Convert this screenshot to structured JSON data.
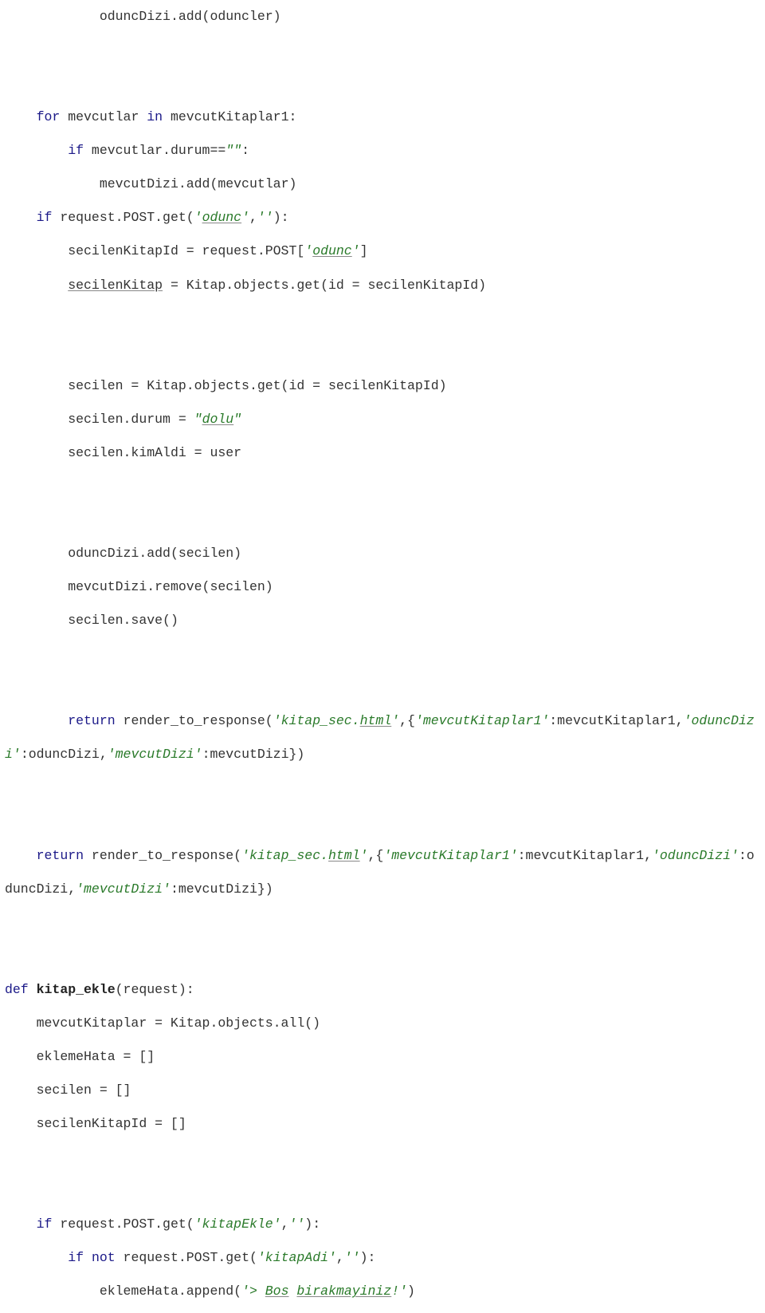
{
  "code": {
    "tokens": [
      {
        "t": "            oduncDizi.add(oduncler)\n"
      },
      {
        "t": "\n"
      },
      {
        "t": "\n"
      },
      {
        "t": "    "
      },
      {
        "t": "for",
        "c": "kw"
      },
      {
        "t": " mevcutlar "
      },
      {
        "t": "in",
        "c": "kw"
      },
      {
        "t": " mevcutKitaplar1:\n"
      },
      {
        "t": "        "
      },
      {
        "t": "if",
        "c": "kw"
      },
      {
        "t": " mevcutlar.durum=="
      },
      {
        "t": "\"\"",
        "c": "str"
      },
      {
        "t": ":\n"
      },
      {
        "t": "            mevcutDizi.add(mevcutlar)\n"
      },
      {
        "t": "    "
      },
      {
        "t": "if",
        "c": "kw"
      },
      {
        "t": " request.POST.get("
      },
      {
        "t": "'",
        "c": "str"
      },
      {
        "t": "odunc",
        "c": "str u"
      },
      {
        "t": "'",
        "c": "str"
      },
      {
        "t": ","
      },
      {
        "t": "''",
        "c": "str"
      },
      {
        "t": "):\n"
      },
      {
        "t": "        secilenKitapId = request.POST["
      },
      {
        "t": "'",
        "c": "str"
      },
      {
        "t": "odunc",
        "c": "str u"
      },
      {
        "t": "'",
        "c": "str"
      },
      {
        "t": "]\n"
      },
      {
        "t": "        "
      },
      {
        "t": "secilenKitap",
        "c": "u"
      },
      {
        "t": " = Kitap.objects.get(id = secilenKitapId)\n"
      },
      {
        "t": "\n"
      },
      {
        "t": "\n"
      },
      {
        "t": "        secilen = Kitap.objects.get(id = secilenKitapId)\n"
      },
      {
        "t": "        secilen.durum = "
      },
      {
        "t": "\"",
        "c": "str"
      },
      {
        "t": "dolu",
        "c": "str u"
      },
      {
        "t": "\"",
        "c": "str"
      },
      {
        "t": "\n"
      },
      {
        "t": "        secilen.kimAldi = user\n"
      },
      {
        "t": "\n"
      },
      {
        "t": "\n"
      },
      {
        "t": "        oduncDizi.add(secilen)\n"
      },
      {
        "t": "        mevcutDizi.remove(secilen)\n"
      },
      {
        "t": "        secilen.save()\n"
      },
      {
        "t": "\n"
      },
      {
        "t": "\n"
      },
      {
        "t": "        "
      },
      {
        "t": "return",
        "c": "kw"
      },
      {
        "t": " render_to_response("
      },
      {
        "t": "'kitap_sec.",
        "c": "str"
      },
      {
        "t": "html",
        "c": "str u"
      },
      {
        "t": "'",
        "c": "str"
      },
      {
        "t": ",{"
      },
      {
        "t": "'mevcutKitaplar1'",
        "c": "str"
      },
      {
        "t": ":mevcutKitaplar1,"
      },
      {
        "t": "'odu",
        "c": "str"
      },
      {
        "t": "ncDizi'",
        "c": "str"
      },
      {
        "t": ":oduncDizi,"
      },
      {
        "t": "'mevcutDizi'",
        "c": "str"
      },
      {
        "t": ":mevcutDizi})\n"
      },
      {
        "t": "\n"
      },
      {
        "t": "\n"
      },
      {
        "t": "    "
      },
      {
        "t": "return",
        "c": "kw"
      },
      {
        "t": " render_to_response("
      },
      {
        "t": "'kitap_sec.",
        "c": "str"
      },
      {
        "t": "html",
        "c": "str u"
      },
      {
        "t": "'",
        "c": "str"
      },
      {
        "t": ",{"
      },
      {
        "t": "'mevcutKitaplar1'",
        "c": "str"
      },
      {
        "t": ":mevcutKitaplar1,"
      },
      {
        "t": "'odu",
        "c": "str"
      },
      {
        "t": "ncDizi'",
        "c": "str"
      },
      {
        "t": ":oduncDizi,"
      },
      {
        "t": "'mevcutDizi'",
        "c": "str"
      },
      {
        "t": ":mevcutDizi})\n"
      },
      {
        "t": "\n"
      },
      {
        "t": "\n"
      },
      {
        "t": "def",
        "c": "kw"
      },
      {
        "t": " "
      },
      {
        "t": "kitap_ekle",
        "c": "fn"
      },
      {
        "t": "(request):\n"
      },
      {
        "t": "    mevcutKitaplar = Kitap.objects.all()\n"
      },
      {
        "t": "    eklemeHata = []\n"
      },
      {
        "t": "    secilen = []\n"
      },
      {
        "t": "    secilenKitapId = []\n"
      },
      {
        "t": "\n"
      },
      {
        "t": "\n"
      },
      {
        "t": "    "
      },
      {
        "t": "if",
        "c": "kw"
      },
      {
        "t": " request.POST.get("
      },
      {
        "t": "'kitapEkle'",
        "c": "str"
      },
      {
        "t": ","
      },
      {
        "t": "''",
        "c": "str"
      },
      {
        "t": "):\n"
      },
      {
        "t": "        "
      },
      {
        "t": "if",
        "c": "kw"
      },
      {
        "t": " "
      },
      {
        "t": "not",
        "c": "kw"
      },
      {
        "t": " request.POST.get("
      },
      {
        "t": "'kitapAdi'",
        "c": "str"
      },
      {
        "t": ","
      },
      {
        "t": "''",
        "c": "str"
      },
      {
        "t": "):\n"
      },
      {
        "t": "            eklemeHata.append("
      },
      {
        "t": "'> ",
        "c": "str"
      },
      {
        "t": "Bos",
        "c": "str u"
      },
      {
        "t": " ",
        "c": "str"
      },
      {
        "t": "birakmayiniz",
        "c": "str u"
      },
      {
        "t": "!'",
        "c": "str"
      },
      {
        "t": ")\n"
      }
    ]
  }
}
